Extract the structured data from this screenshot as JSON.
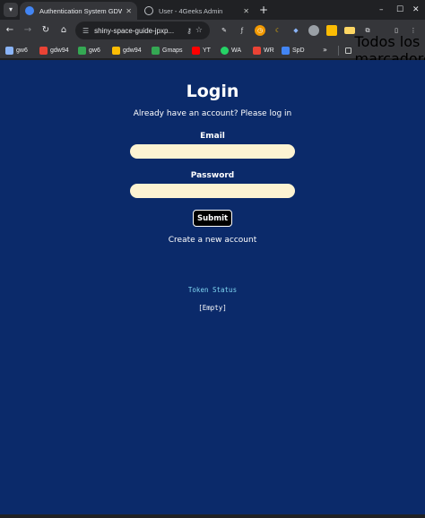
{
  "browser": {
    "tabs": [
      {
        "title": "Authentication System GDW",
        "active": true,
        "close": "✕"
      },
      {
        "title": "User - 4Geeks Admin",
        "active": false,
        "close": "✕"
      }
    ],
    "new_tab": "+",
    "window_controls": {
      "minimize": "–",
      "maximize": "☐",
      "close": "✕"
    },
    "url": "shiny-space-guide-jpxp...",
    "bookmarks": [
      {
        "label": "gw6",
        "color": "#8ab4f8"
      },
      {
        "label": "gdw94",
        "color": "#ea4335"
      },
      {
        "label": "gw6",
        "color": "#34a853"
      },
      {
        "label": "gdw94",
        "color": "#fbbc04"
      },
      {
        "label": "Gmaps",
        "color": "#34a853"
      },
      {
        "label": "YT",
        "color": "#ff0000"
      },
      {
        "label": "WA",
        "color": "#25d366"
      },
      {
        "label": "WR",
        "color": "#ea4335"
      },
      {
        "label": "SpD",
        "color": "#4285f4"
      }
    ],
    "bookmarks_more": "»",
    "all_bookmarks": "Todos los marcadores"
  },
  "page": {
    "title": "Login",
    "subtitle": "Already have an account? Please log in",
    "email_label": "Email",
    "email_value": "",
    "password_label": "Password",
    "password_value": "",
    "submit_label": "Submit",
    "create_account": "Create a new account",
    "token_status_label": "Token Status",
    "token_value": "[Empty]"
  },
  "colors": {
    "page_background": "#0b2a6a",
    "input_background": "#fdf3d2",
    "token_label": "#7fd4f0"
  }
}
